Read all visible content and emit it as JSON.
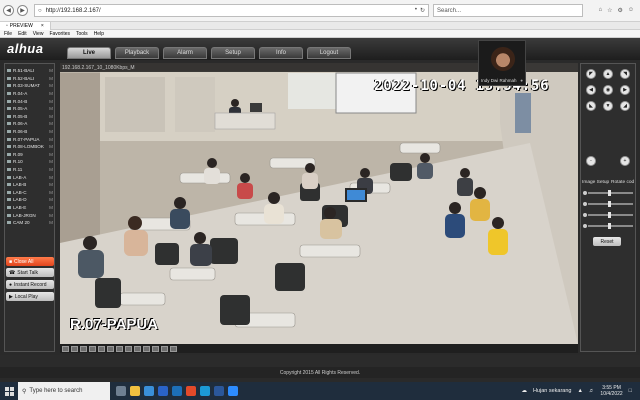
{
  "browser": {
    "url": "http://192.168.2.167/",
    "search_placeholder": "Search...",
    "tab_title": "PREVIEW",
    "menu": [
      "File",
      "Edit",
      "View",
      "Favorites",
      "Tools",
      "Help"
    ]
  },
  "app": {
    "logo": "alhua",
    "nav": [
      {
        "label": "Live",
        "active": true
      },
      {
        "label": "Playback"
      },
      {
        "label": "Alarm"
      },
      {
        "label": "Setup"
      },
      {
        "label": "Info"
      },
      {
        "label": "Logout"
      }
    ]
  },
  "channels": [
    {
      "label": "R.51-BALI",
      "flag": "M"
    },
    {
      "label": "R.52-BALI",
      "flag": "M"
    },
    {
      "label": "R.03-SUMAT",
      "flag": "M"
    },
    {
      "label": "R.04-A",
      "flag": "M"
    },
    {
      "label": "R.04-B",
      "flag": "M"
    },
    {
      "label": "R.05-A",
      "flag": "M"
    },
    {
      "label": "R.05-B",
      "flag": "M"
    },
    {
      "label": "R.06-A",
      "flag": "M"
    },
    {
      "label": "R.06-B",
      "flag": "M"
    },
    {
      "label": "R.07-PAPUA",
      "flag": "M"
    },
    {
      "label": "R.08-LOMBOK",
      "flag": "M"
    },
    {
      "label": "R.09",
      "flag": "M"
    },
    {
      "label": "R.10",
      "flag": "M"
    },
    {
      "label": "R.11",
      "flag": "M"
    },
    {
      "label": "LAB-A",
      "flag": "M"
    },
    {
      "label": "LAB-B",
      "flag": "M"
    },
    {
      "label": "LAB-C",
      "flag": "M"
    },
    {
      "label": "LAB-D",
      "flag": "M"
    },
    {
      "label": "LAB-E",
      "flag": "M"
    },
    {
      "label": "LAB-JRGN",
      "flag": "M"
    },
    {
      "label": "CAM 20",
      "flag": "M"
    }
  ],
  "left_buttons": {
    "close_all": "Close All",
    "start_talk": "Start Talk",
    "instant_record": "Instant Record",
    "local_play": "Local Play"
  },
  "video": {
    "header": "192.168.2.167_10_1080Kbps_M",
    "timestamp": "2022-10-04  15:54:56",
    "camera_name": "R.07-PAPUA"
  },
  "pip": {
    "name": "Indy Dwi Rahmah"
  },
  "right_panel": {
    "zoom_minus": "-",
    "zoom_plus": "+",
    "image_setup": "Image Setup",
    "rotate": "Rotate cod",
    "reset": "Reset"
  },
  "footer": {
    "copyright": "Copyright 2015 All Rights Reserved."
  },
  "taskbar": {
    "search": "Type here to search",
    "weather": "Hujan sekarang",
    "time": "3:55 PM",
    "date": "10/4/2022"
  },
  "colors": {
    "accent_red": "#e2451e",
    "header_dark": "#1e1e1e",
    "taskbar": "#1f2d3d"
  }
}
